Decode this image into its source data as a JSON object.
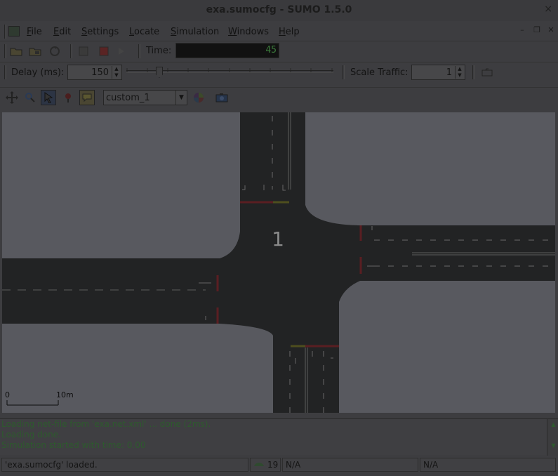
{
  "window": {
    "title": "exa.sumocfg - SUMO 1.5.0",
    "close_glyph": "×"
  },
  "menu": {
    "items": [
      "File",
      "Edit",
      "Settings",
      "Locate",
      "Simulation",
      "Windows",
      "Help"
    ],
    "mdi": [
      "–",
      "❐",
      "✕"
    ]
  },
  "toolbar": {
    "time_label": "Time:",
    "time_value": "45",
    "delay_label": "Delay (ms):",
    "delay_value": "150",
    "scale_label": "Scale Traffic:",
    "scale_value": "1"
  },
  "view_toolbar": {
    "scheme": "custom_1"
  },
  "canvas": {
    "junction_label": "1",
    "scale_start": "0",
    "scale_end": "10m"
  },
  "console": {
    "lines": [
      "Loading net-file from 'exa.net.xml' ... done (2ms).",
      "Loading done.",
      "Simulation started with time: 0.00"
    ]
  },
  "status": {
    "message": "'exa.sumocfg' loaded.",
    "vehicle_count": "19",
    "field2": "N/A",
    "field3": "N/A"
  }
}
